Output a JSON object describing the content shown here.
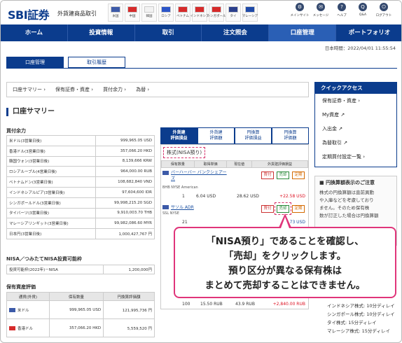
{
  "header": {
    "logo": "SBI証券",
    "logo_sub": "外貨建商品取引",
    "flags": [
      {
        "label": "米国",
        "color": "#3c5aa8"
      },
      {
        "label": "中国",
        "color": "#d62b2b"
      },
      {
        "label": "韓国",
        "color": "#f2f2f2"
      },
      {
        "label": "ロシア",
        "color": "#2b55c8"
      },
      {
        "label": "ベトナム",
        "color": "#d62b2b"
      },
      {
        "label": "インドネシア",
        "color": "#d62b2b"
      },
      {
        "label": "シンガポール",
        "color": "#d62b2b"
      },
      {
        "label": "タイ",
        "color": "#2b3f8c"
      },
      {
        "label": "マレーシア",
        "color": "#1f4aa8"
      }
    ],
    "icons": [
      {
        "glyph": "⚙",
        "label": "メインサイト"
      },
      {
        "glyph": "✉",
        "label": "メッセージ"
      },
      {
        "glyph": "?",
        "label": "ヘルプ"
      },
      {
        "glyph": "Q",
        "label": "Q&A"
      },
      {
        "glyph": "⏻",
        "label": "ログアウト"
      }
    ]
  },
  "nav": [
    "ホーム",
    "投資情報",
    "取引",
    "注文照会",
    "口座管理",
    "ポートフォリオ"
  ],
  "datetime": "日本時間：2022/04/01 11:55:54",
  "subtabs": [
    "口座管理",
    "取引履歴"
  ],
  "crumbs": [
    "口座サマリー ›",
    "保有証券・資産 ›",
    "買付余力 ›",
    "為替 ›"
  ],
  "section_title": "口座サマリー",
  "buying_power_label": "買付余力",
  "balances": [
    [
      "米ドル(3営業日後)",
      "999,965.05 USD"
    ],
    [
      "香港ドル(3営業日後)",
      "357,066.20 HKD"
    ],
    [
      "韓国ウォン(3営業日後)",
      "8,139,666 KRW"
    ],
    [
      "ロシアルーブル(4営業日後)",
      "964,000.00 RUB"
    ],
    [
      "ベトナムドン(3営業日後)",
      "108,682,840 VND"
    ],
    [
      "インドネシアルピア(3営業日後)",
      "97,604,600 IDR"
    ],
    [
      "シンガポールドル(3営業日後)",
      "99,998,215.20 SGD"
    ],
    [
      "タイバーツ(3営業日後)",
      "9,910,003.70 THB"
    ],
    [
      "マレーシアリンギット(3営業日後)",
      "99,982,086.60 MYR"
    ],
    [
      "日本円(3営業日後)",
      "1,000,427,767 円"
    ]
  ],
  "nisa_label": "NISA／つみたてNISA投資可能枠",
  "nisa_row": [
    "投資可能枠(2022年)－NISA",
    "1,200,000円"
  ],
  "asset_label": "保有資産評価",
  "asset_headers": [
    "通貨(外貨)",
    "保有数量",
    "円換算評価額"
  ],
  "assets": [
    {
      "name": "米ドル",
      "qty": "999,965.05 USD",
      "value": "121,995,736 円",
      "flag": "#3c5aa8"
    },
    {
      "name": "香港ドル",
      "qty": "357,066.20 HKD",
      "value": "5,559,520 円",
      "flag": "#d62b2b"
    }
  ],
  "panel_tabs": [
    "外貨建\n評価損益",
    "外貨建\n評価額",
    "円換算\n評価損益",
    "円換算\n評価額"
  ],
  "nisa_account_label": "株式(NISA預り)",
  "holding_headers": [
    "保有数量",
    "取得単価",
    "現在値",
    "外貨建評価損益"
  ],
  "holdings": [
    {
      "name": "バーハーバー バンクシェアーズ",
      "code": "BHB NYSE American",
      "qty": "1",
      "cost": "6.04 USD",
      "price": "28.62 USD",
      "pl": "+22.58 USD"
    },
    {
      "name": "サソル ADR",
      "code": "SSL NYSE",
      "qty": "21",
      "cost": "",
      "price": "",
      "pl": "2.73 USD"
    },
    {
      "name": "",
      "code": "",
      "qty": "100",
      "cost": "15.50 RUB",
      "price": "43.9 RUB",
      "pl": "+2,840.00 RUB"
    }
  ],
  "buttons": {
    "buy": "買付",
    "sell": "売却",
    "fix": "定期"
  },
  "quick_access": {
    "title": "クイックアクセス",
    "items": [
      "保有証券・資産 ›",
      "My資産 ↗",
      "入出金 ↗",
      "為替取引 ↗",
      "定期買付設定一覧 ›"
    ]
  },
  "notice": {
    "title": "円換算額表示のご注意",
    "lines": [
      "株式の円換算額は直前異動",
      "や入庫などを考慮しており",
      "ません。そのため保有株",
      "数が訂正した場合は円換算額"
    ]
  },
  "delays": [
    "インドネシア株式: 10分ディレイ",
    "シンガポール株式: 10分ディレイ",
    "タイ株式: 15分ディレイ",
    "マレーシア株式: 15分ディレイ"
  ],
  "callout": {
    "line1": "「NISA預り」であることを確認し、",
    "line2": "「売却」をクリックします。",
    "line3": "預り区分が異なる保有株は",
    "line4": "まとめて売却することはできません。"
  }
}
